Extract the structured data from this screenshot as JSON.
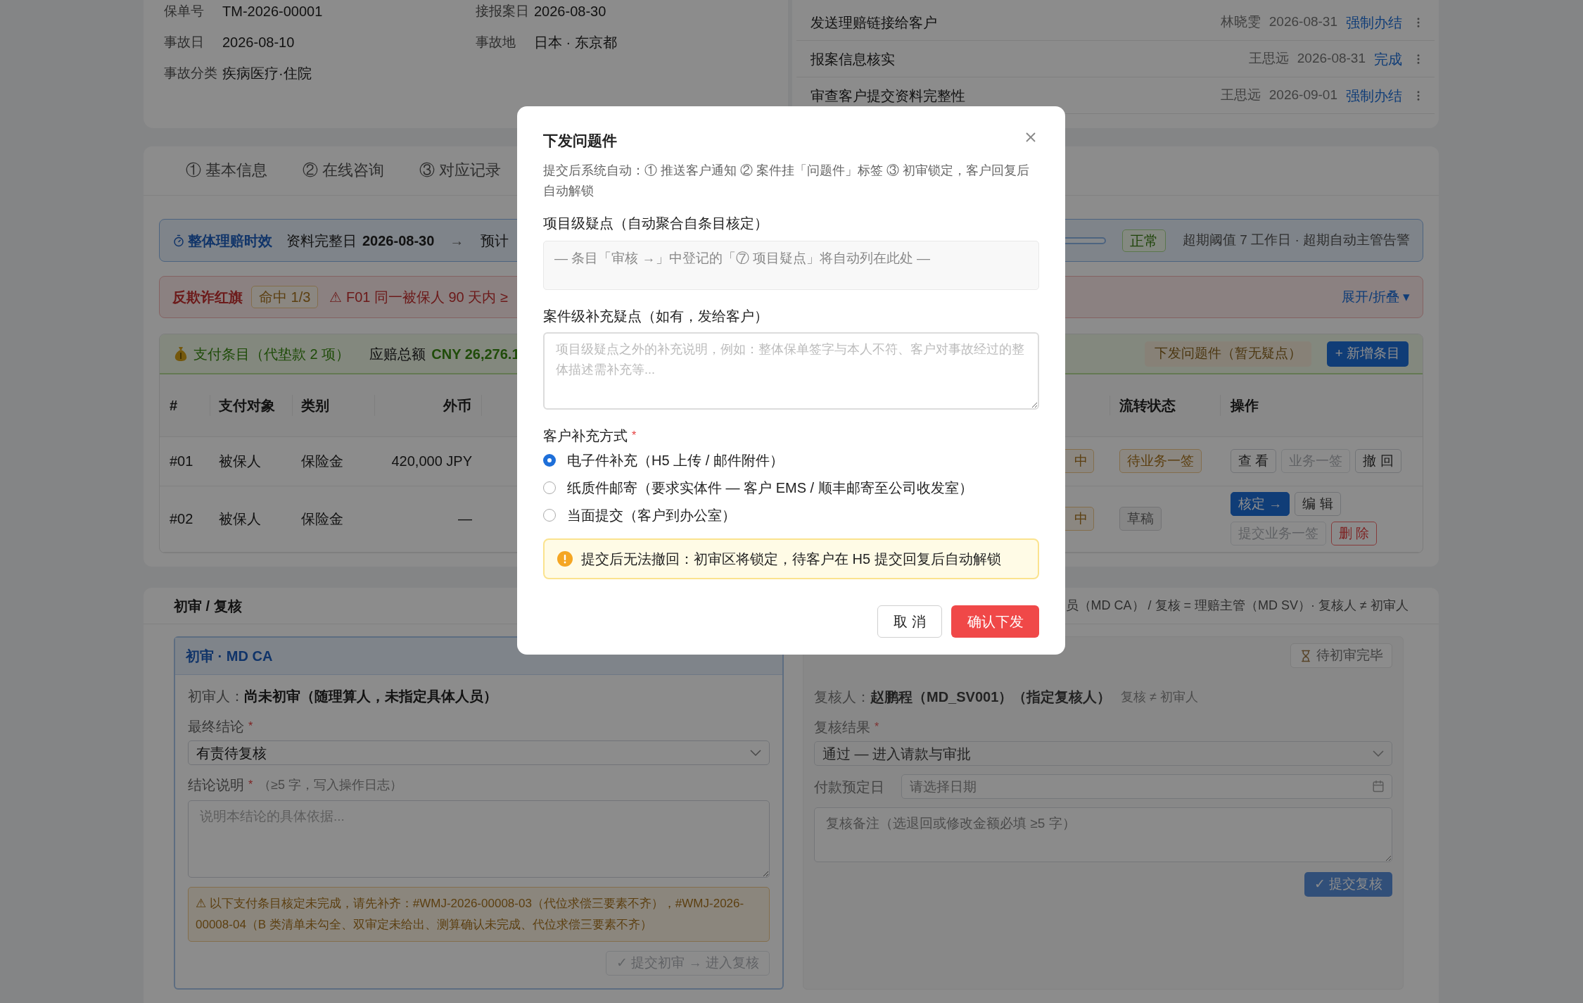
{
  "policy_info": [
    {
      "label": "保单号",
      "value": "TM-2026-00001"
    },
    {
      "label": "接报案日",
      "value": "2026-08-30"
    },
    {
      "label": "事故日",
      "value": "2026-08-10"
    },
    {
      "label": "事故地",
      "value": "日本 · 东京都"
    },
    {
      "label": "事故分类",
      "value": "疾病医疗·住院"
    }
  ],
  "tasks": [
    {
      "title": "发送理赔链接给客户",
      "assignee": "林晓雯",
      "date": "2026-08-31",
      "action": "强制办结"
    },
    {
      "title": "报案信息核实",
      "assignee": "王思远",
      "date": "2026-08-31",
      "action": "完成"
    },
    {
      "title": "审查客户提交资料完整性",
      "assignee": "王思远",
      "date": "2026-09-01",
      "action": "强制办结"
    }
  ],
  "tabs": [
    {
      "label": "① 基本信息",
      "selected": false
    },
    {
      "label": "② 在线咨询",
      "selected": false
    },
    {
      "label": "③ 对应记录",
      "selected": false
    }
  ],
  "timeliness": {
    "title": "整体理赔时效",
    "complete_label": "资料完整日",
    "complete_date": "2026-08-30",
    "arrow": "→",
    "expected": "预计",
    "status": "正常",
    "note": "超期阈值 7 工作日 · 超期自动主管告警"
  },
  "fraud": {
    "title": "反欺诈红旗",
    "hits": "命中 1/3",
    "rule": "⚠ F01 同一被保人 90 天内 ≥",
    "toggle": "展开/折叠 ▾"
  },
  "payments": {
    "title": "支付条目（代垫款 2 项）",
    "total_label": "应赔总额",
    "total": "CNY 26,276.1",
    "issue_button": {
      "label": "下发问题件（暂无疑点）",
      "disabled": true
    },
    "add_button": "+ 新增条目",
    "columns": [
      "#",
      "支付对象",
      "类别",
      "外币",
      "流转状态",
      "操作"
    ],
    "rows": [
      {
        "no": "#01",
        "payee": "被保人",
        "category": "保险金",
        "foreign": "420,000 JPY",
        "hidden_badge": "中",
        "status": {
          "label": "待业务一签",
          "kind": "warning"
        },
        "actions": [
          {
            "label": "查 看",
            "kind": "default",
            "disabled": false
          },
          {
            "label": "业务一签",
            "kind": "default",
            "disabled": true
          },
          {
            "label": "撤 回",
            "kind": "default",
            "disabled": false
          }
        ]
      },
      {
        "no": "#02",
        "payee": "被保人",
        "category": "保险金",
        "foreign": "—",
        "hidden_badge": "中",
        "status": {
          "label": "草稿",
          "kind": "neutral"
        },
        "actions": [
          {
            "label": "核定 →",
            "kind": "primary",
            "disabled": false
          },
          {
            "label": "编 辑",
            "kind": "default",
            "disabled": false
          },
          {
            "label": "提交业务一签",
            "kind": "default",
            "disabled": true
          },
          {
            "label": "删 除",
            "kind": "danger",
            "disabled": false
          }
        ]
      }
    ]
  },
  "review": {
    "title": "初审 / 复核",
    "rule_note": "员（MD CA） / 复核 = 理赔主管（MD SV）· 复核人 ≠ 初审人",
    "first": {
      "title": "初审 · MD CA",
      "reviewer_label": "初审人：",
      "reviewer": "尚未初审（随理算人，未指定具体人员）",
      "conclusion_label": "最终结论",
      "conclusion_mark": "*",
      "conclusion_value": "有责待复核",
      "note_label": "结论说明",
      "note_mark": "*",
      "note_hint": "（≥5 字，写入操作日志）",
      "note_placeholder": "说明本结论的具体依据...",
      "warning": "⚠ 以下支付条目核定未完成，请先补齐：#WMJ-2026-00008-03（代位求偿三要素不齐），#WMJ-2026-00008-04（B 类清单未勾全、双审定未给出、测算确认未完成、代位求偿三要素不齐）",
      "submit": {
        "label": "✓ 提交初审 → 进入复核",
        "disabled": true
      }
    },
    "second": {
      "disabled": true,
      "status": "待初审完毕",
      "reviewer_label": "复核人：",
      "reviewer": "赵鹏程（MD_SV001）（指定复核人）",
      "reviewer_note": "复核 ≠ 初审人",
      "result_label": "复核结果",
      "result_mark": "*",
      "result_value": "通过 — 进入请款与审批",
      "date_label": "付款预定日",
      "date_placeholder": "请选择日期",
      "remark_placeholder": "复核备注（选退回或修改金额必填 ≥5 字）",
      "submit": {
        "label": "✓ 提交复核",
        "disabled": true
      }
    }
  },
  "modal": {
    "title": "下发问题件",
    "description": "提交后系统自动：① 推送客户通知 ② 案件挂「问题件」标签 ③ 初审锁定，客户回复后自动解锁",
    "item_label": "项目级疑点（自动聚合自条目核定）",
    "item_empty": "— 条目「审核 →」中登记的「⑦ 项目疑点」将自动列在此处 —",
    "case_label": "案件级补充疑点（如有，发给客户）",
    "case_placeholder": "项目级疑点之外的补充说明，例如：整体保单签字与本人不符、客户对事故经过的整体描述需补充等...",
    "method_label": "客户补充方式",
    "method_mark": "*",
    "methods": [
      {
        "label": "电子件补充（H5 上传 / 邮件附件）",
        "selected": true
      },
      {
        "label": "纸质件邮寄（要求实体件 — 客户 EMS / 顺丰邮寄至公司收发室）",
        "selected": false
      },
      {
        "label": "当面提交（客户到办公室）",
        "selected": false
      }
    ],
    "warning": "提交后无法撤回：初审区将锁定，待客户在 H5 提交回复后自动解锁",
    "cancel": "取 消",
    "confirm": "确认下发"
  }
}
